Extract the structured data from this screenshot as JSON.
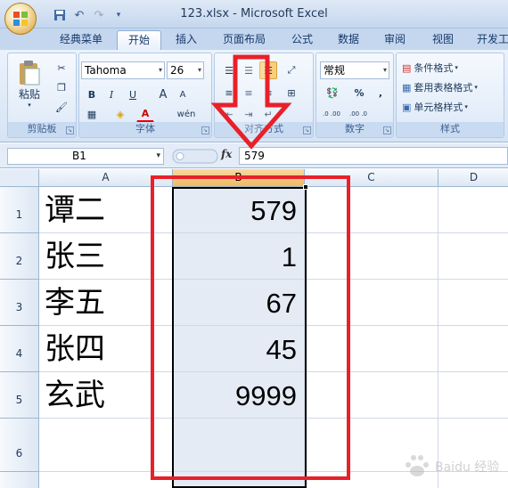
{
  "window": {
    "title": "123.xlsx - Microsoft Excel"
  },
  "qat": {
    "icons": [
      "save-icon",
      "undo-icon",
      "redo-icon",
      "customize-icon"
    ]
  },
  "tabs": [
    "经典菜单",
    "开始",
    "插入",
    "页面布局",
    "公式",
    "数据",
    "审阅",
    "视图",
    "开发工"
  ],
  "active_tab": "开始",
  "ribbon": {
    "clipboard": {
      "label": "剪贴板",
      "paste": "粘贴"
    },
    "font": {
      "label": "字体",
      "name": "Tahoma",
      "size": "26",
      "bold": "B",
      "italic": "I",
      "underline": "U",
      "grow": "A",
      "shrink": "A",
      "font_color": "A",
      "phonetic": "wén"
    },
    "alignment": {
      "label": "对齐方式"
    },
    "number": {
      "label": "数字",
      "format": "常规",
      "percent": "%",
      "comma": ",",
      "inc_decimal": ".0 .00",
      "dec_decimal": ".00 .0"
    },
    "styles": {
      "label": "样式",
      "conditional": "条件格式",
      "table": "套用表格格式",
      "cell": "单元格样式"
    }
  },
  "formula_bar": {
    "name_box": "B1",
    "fx": "fx",
    "value": "579"
  },
  "columns": [
    "A",
    "B",
    "C",
    "D"
  ],
  "selected_column": "B",
  "rows": [
    {
      "num": "1",
      "name": "谭二",
      "value": "579"
    },
    {
      "num": "2",
      "name": "张三",
      "value": "1"
    },
    {
      "num": "3",
      "name": "李五",
      "value": "67"
    },
    {
      "num": "4",
      "name": "张四",
      "value": "45"
    },
    {
      "num": "5",
      "name": "玄武",
      "value": "9999"
    },
    {
      "num": "6",
      "name": "",
      "value": ""
    }
  ],
  "colors": {
    "annotation": "#e8202a",
    "selection_fill": "#e5ebf5",
    "ribbon": "#dde9f7"
  },
  "watermark": "Baidu 经验"
}
